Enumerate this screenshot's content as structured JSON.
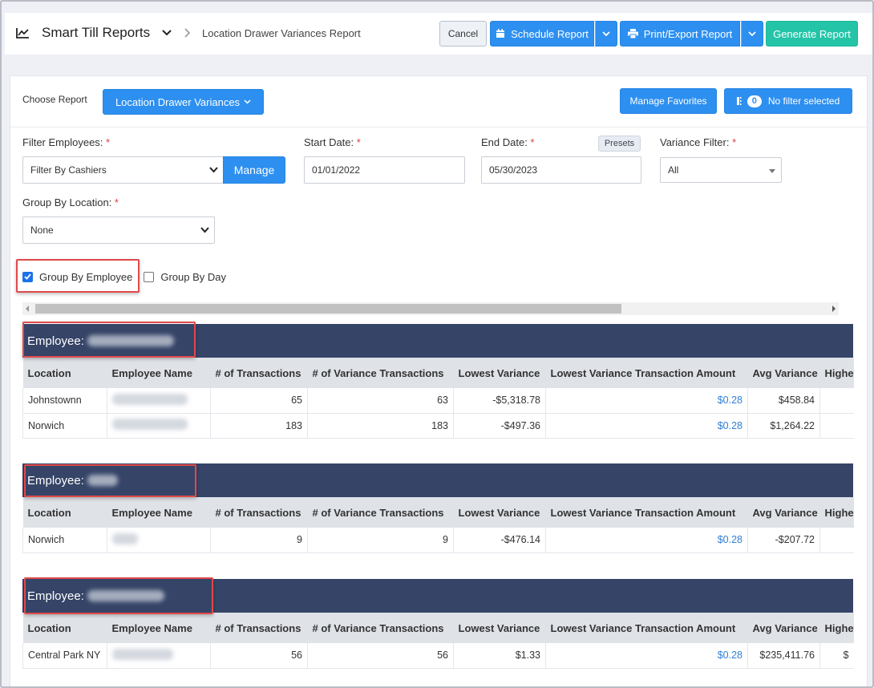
{
  "header": {
    "app_title": "Smart Till Reports",
    "breadcrumb": "Location Drawer Variances Report",
    "buttons": {
      "cancel": "Cancel",
      "schedule": "Schedule Report",
      "print": "Print/Export Report",
      "generate": "Generate Report"
    }
  },
  "report": {
    "choose_label": "Choose Report",
    "selected": "Location Drawer Variances",
    "manage_favorites": "Manage Favorites",
    "filter_count": "0",
    "filter_status": "No filter selected"
  },
  "filters": {
    "employees": {
      "label": "Filter Employees:",
      "value": "Filter By Cashiers",
      "manage": "Manage"
    },
    "start_date": {
      "label": "Start Date:",
      "value": "01/01/2022"
    },
    "end_date": {
      "label": "End Date:",
      "value": "05/30/2023",
      "presets": "Presets"
    },
    "variance": {
      "label": "Variance Filter:",
      "value": "All"
    },
    "group_location": {
      "label": "Group By Location:",
      "value": "None"
    },
    "group_employee": {
      "label": "Group By Employee",
      "checked": true
    },
    "group_day": {
      "label": "Group By Day",
      "checked": false
    },
    "required_mark": "*"
  },
  "table": {
    "group_prefix": "Employee:",
    "columns": [
      "Location",
      "Employee Name",
      "# of Transactions",
      "# of Variance Transactions",
      "Lowest Variance",
      "Lowest Variance Transaction Amount",
      "Avg Variance",
      "Highe"
    ],
    "groups": [
      {
        "rows": [
          {
            "location": "Johnstownn",
            "transactions": "65",
            "variance_transactions": "63",
            "lowest_variance": "-$5,318.78",
            "lowest_amount": "$0.28",
            "avg_variance": "$458.84",
            "highest": ""
          },
          {
            "location": "Norwich",
            "transactions": "183",
            "variance_transactions": "183",
            "lowest_variance": "-$497.36",
            "lowest_amount": "$0.28",
            "avg_variance": "$1,264.22",
            "highest": ""
          }
        ]
      },
      {
        "rows": [
          {
            "location": "Norwich",
            "transactions": "9",
            "variance_transactions": "9",
            "lowest_variance": "-$476.14",
            "lowest_amount": "$0.28",
            "avg_variance": "-$207.72",
            "highest": ""
          }
        ]
      },
      {
        "rows": [
          {
            "location": "Central Park NY",
            "transactions": "56",
            "variance_transactions": "56",
            "lowest_variance": "$1.33",
            "lowest_amount": "$0.28",
            "avg_variance": "$235,411.76",
            "highest": "$"
          }
        ]
      }
    ]
  },
  "colors": {
    "primary": "#2d8ff0",
    "generate": "#23c4a7",
    "group_header": "#354467",
    "highlight": "#e04a4a",
    "link": "#2d7fd6"
  }
}
